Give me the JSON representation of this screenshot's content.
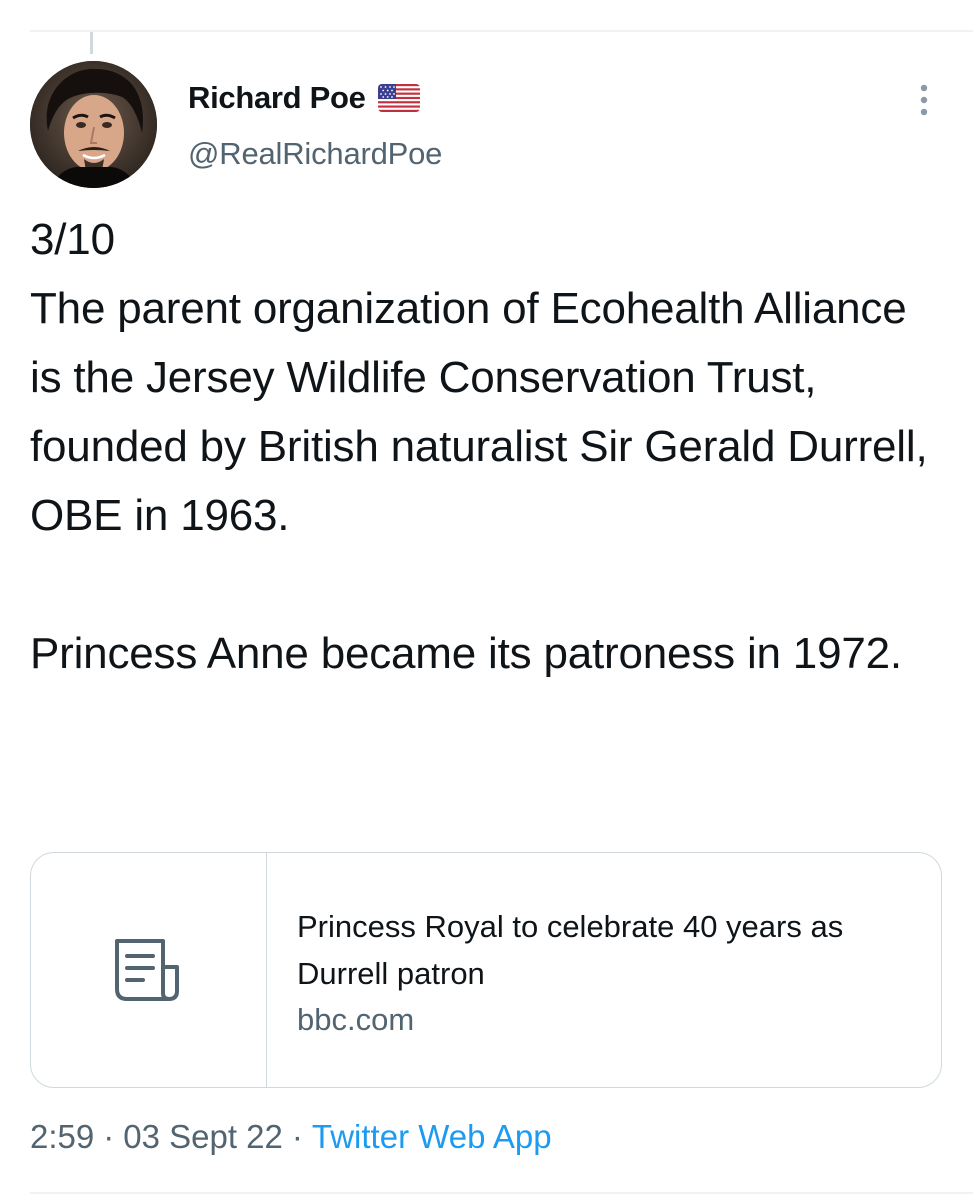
{
  "tweet": {
    "author": {
      "display_name": "Richard Poe",
      "handle": "@RealRichardPoe",
      "badge_icon": "us-flag-icon"
    },
    "text": "3/10\nThe parent organization of Ecohealth Alliance is the Jersey Wildlife Conservation Trust, founded by British naturalist Sir Gerald Durrell, OBE in 1963.\n\nPrincess Anne became its patroness in 1972.",
    "link_card": {
      "icon": "article-icon",
      "title": "Princess Royal to celebrate 40 years as Durrell patron",
      "domain": "bbc.com"
    },
    "meta": {
      "time": "2:59",
      "separator": "·",
      "date": "03 Sept 22",
      "source": "Twitter Web App"
    }
  },
  "colors": {
    "text": "#0f1419",
    "secondary": "#536471",
    "accent": "#1d9bf0",
    "border": "#cfd9de"
  }
}
